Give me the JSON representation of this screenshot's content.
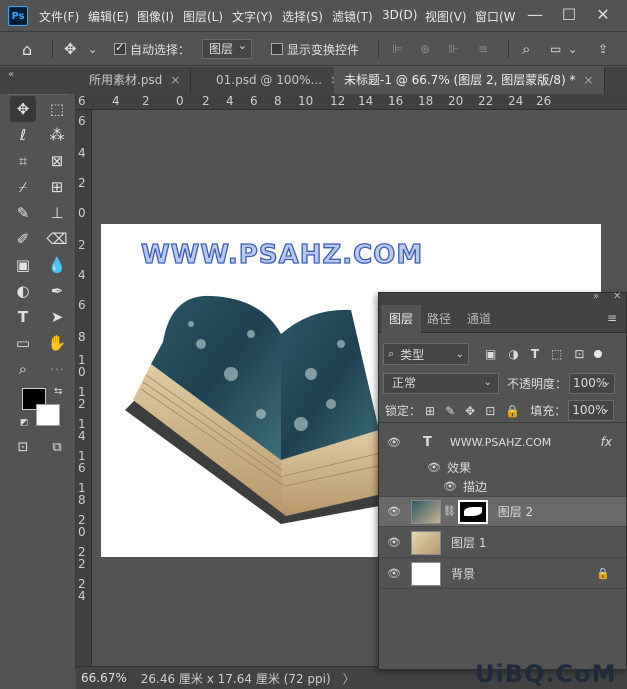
{
  "app": {
    "logo": "Ps"
  },
  "menu": [
    "文件(F)",
    "编辑(E)",
    "图像(I)",
    "图层(L)",
    "文字(Y)",
    "选择(S)",
    "滤镜(T)",
    "3D(D)",
    "视图(V)",
    "窗口(W"
  ],
  "window_controls": {
    "minimize": "—",
    "maximize": "☐",
    "close": "✕"
  },
  "options": {
    "auto_select_label": "自动选择：",
    "auto_select_checked": true,
    "auto_select_target": "图层",
    "show_transform_label": "显示变换控件",
    "show_transform_checked": false
  },
  "tabs": [
    {
      "label": "所用素材.psd",
      "active": false
    },
    {
      "label": "01.psd @ 100%...",
      "active": false
    },
    {
      "label": "未标题-1 @ 66.7% (图层 2, 图层蒙版/8) *",
      "active": true
    }
  ],
  "tab_close": "×",
  "ruler": {
    "h": [
      "6",
      "4",
      "2",
      "0",
      "2",
      "4",
      "6",
      "8",
      "10",
      "12",
      "14",
      "16",
      "18",
      "20",
      "22",
      "24",
      "26"
    ],
    "v": [
      "6",
      "4",
      "2",
      "0",
      "2",
      "4",
      "6",
      "8",
      "1\n0",
      "1\n2",
      "1\n4",
      "1\n6",
      "1\n8",
      "2\n0",
      "2\n2",
      "2\n4"
    ]
  },
  "canvas": {
    "title_text": "WWW.PSAHZ.COM"
  },
  "status": {
    "zoom": "66.67%",
    "doc_info": "26.46 厘米 x 17.64 厘米 (72 ppi)",
    "arrow": "〉"
  },
  "layers_panel": {
    "tabs": [
      "图层",
      "路径",
      "通道"
    ],
    "filter_label": "类型",
    "blend_mode": "正常",
    "opacity_label": "不透明度：",
    "opacity_value": "100%",
    "lock_label": "锁定：",
    "fill_label": "填充：",
    "fill_value": "100%",
    "layers": [
      {
        "name": "WWW.PSAHZ.COM",
        "type": "text",
        "fx": "fx",
        "thumb_glyph": "T"
      },
      {
        "name": "效果",
        "type": "effect-group"
      },
      {
        "name": "描边",
        "type": "effect"
      },
      {
        "name": "图层 2",
        "type": "image-mask",
        "selected": true
      },
      {
        "name": "图层 1",
        "type": "image"
      },
      {
        "name": "背景",
        "type": "background",
        "locked": true
      }
    ]
  },
  "watermark": "UiBQ.CoM"
}
